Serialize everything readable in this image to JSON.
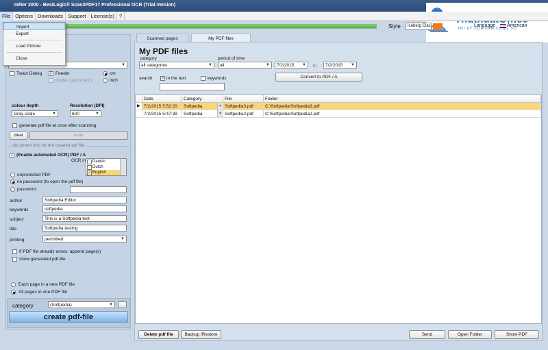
{
  "window": {
    "title": "mêter 2000 - BestLogic® Scan2PDF17 Professional OCR (Trial-Version)"
  },
  "menu": {
    "items": [
      "File",
      "Options",
      "Downloads",
      "Support",
      "License(s)",
      "?"
    ]
  },
  "file_menu": {
    "items": [
      "Import",
      "Export",
      "Load Picture",
      "Close"
    ]
  },
  "top": {
    "progress_fraction": 1.0,
    "style_label": "Style",
    "style_value": "Iceberg Classic",
    "language_label": "Language",
    "language_value": "American"
  },
  "logo": {
    "name": "ThuthuatOffice",
    "tagline": "TRI KỶ CỦA DÂN CÔNG SỞ"
  },
  "scan": {
    "twain_label": "Twain Dialog",
    "feeder_label": "Feeder",
    "duplex_label": "duplex (automatic)",
    "cm_label": "cm",
    "inch_label": "inch",
    "colour_depth_label": "colour depth",
    "colour_depth_value": "Gray scale",
    "resolution_label": "Resolution (DPI)",
    "resolution_value": "600",
    "generate_label": "generate pdf file at once after scanning",
    "clear_label": "clear",
    "scan_label": "scan"
  },
  "docinfo": {
    "group_label": "document info for the created pdf file",
    "ocr_label": "(Enable automated OCR) PDF / A",
    "ocr_in_label": "OCR in",
    "languages": [
      "Danish",
      "Dutch",
      "English"
    ],
    "unprotected_label": "unprotected PDF",
    "no_password_label": "no password (to open the pdf file)",
    "password_label": "password",
    "author_label": "author",
    "author_value": "Softpedia Editor",
    "keywords_label": "keywords",
    "keywords_value": "softpedia",
    "subject_label": "subject",
    "subject_value": "This is a Softpedia test",
    "title_label": "title",
    "title_value": "Softpedia testing",
    "printing_label": "printing",
    "printing_value": "permitted",
    "append_label": "If PDF file already exists: append page(s)",
    "show_label": "show generated pdf-file",
    "each_page_label": "Each page in a new PDF file",
    "all_pages_label": "All pages in one PDF file",
    "category_label": "category",
    "category_value": "(Softpedia)",
    "create_label": "create pdf-file"
  },
  "tabs": [
    "Scanned pages",
    "My PDF files"
  ],
  "pdf": {
    "heading": "My PDF files",
    "category_label": "category",
    "category_value": "all categories",
    "period_label": "period of time",
    "period_value": "all",
    "date_from": "7/2/2015",
    "to_label": "to",
    "date_to": "7/2/2015",
    "search_label": "search",
    "in_text_label": "in the text",
    "keywords_label": "keywords",
    "convert_label": "Convert to PDF / A",
    "columns": [
      "Date",
      "Category",
      "File",
      "Folder"
    ],
    "rows": [
      {
        "date": "7/2/2015 5:52:20",
        "category": "Softpedia",
        "file": "Softpedia3.pdf",
        "folder": "C:\\Softpedia\\Softpedia3.pdf"
      },
      {
        "date": "7/2/2015 5:47:39",
        "category": "Softpedia",
        "file": "Softpedia2.pdf",
        "folder": "C:\\Softpedia\\Softpedia2.pdf"
      }
    ],
    "delete_label": "Delete pdf file",
    "backup_label": "Backup /Restore",
    "send_label": "Send",
    "open_folder_label": "Open Folder",
    "show_pdf_label": "Show PDF"
  },
  "colors": {
    "selection": "#f7d67c",
    "accent": "#1f6fbf",
    "logo_orange": "#f07a22"
  }
}
